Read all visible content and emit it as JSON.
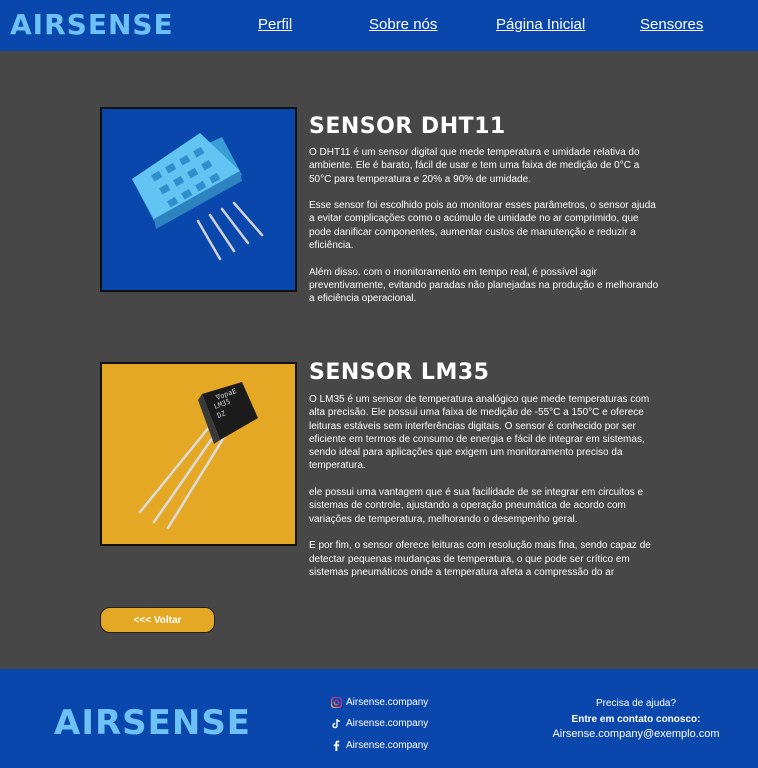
{
  "header": {
    "logo": "AIRSENSE",
    "nav": [
      "Perfil",
      "Sobre nós",
      "Página Inicial",
      "Sensores"
    ]
  },
  "sensors": [
    {
      "title": "SENSOR DHT11",
      "image_bg": "#0a47ad",
      "paragraphs": [
        "O DHT11 é um sensor digital que mede temperatura e umidade relativa do ambiente. Ele é barato, fácil de usar e tem uma faixa de medição de 0°C a 50°C para temperatura e 20% a 90% de umidade.",
        "Esse sensor foi escolhido pois ao monitorar esses parâmetros, o sensor ajuda a evitar complicações como o acúmulo de umidade no ar comprimido, que pode danificar componentes, aumentar custos de manutenção e reduzir a eficiência.",
        "Além disso. com o monitoramento em tempo real, é possível agir preventivamente, evitando paradas não planejadas na produção e melhorando a eficiência operacional."
      ]
    },
    {
      "title": "SENSOR LM35",
      "image_bg": "#e5a825",
      "chip_text": [
        "∇opaE",
        "LM35",
        "DZ"
      ],
      "paragraphs": [
        "O LM35 é um sensor de temperatura analógico que mede temperaturas com alta precisão. Ele possui uma faixa de medição de -55°C a 150°C e oferece leituras estáveis sem interferências digitais. O sensor é conhecido por ser eficiente em termos de consumo de energia e fácil de integrar em sistemas, sendo ideal para aplicações que exigem um monitoramento preciso da temperatura.",
        "ele possui uma vantagem que é sua facilidade de se integrar em circuitos e sistemas de controle, ajustando a operação pneumática de acordo com variações de temperatura, melhorando o desempenho geral.",
        "E por fim, o sensor oferece leituras com resolução mais fina, sendo capaz de detectar pequenas mudanças de temperatura, o que pode ser crítico em sistemas pneumáticos onde a temperatura afeta a compressão do ar"
      ]
    }
  ],
  "back_button": "<<< Voltar",
  "footer": {
    "logo": "AIRSENSE",
    "social": [
      {
        "icon": "instagram-icon",
        "label": "Airsense.company"
      },
      {
        "icon": "tiktok-icon",
        "label": "Airsense.company"
      },
      {
        "icon": "facebook-icon",
        "label": "Airsense.company"
      }
    ],
    "help_question": "Precisa de ajuda?",
    "help_contact": "Entre em contato conosco:",
    "help_email": "Airsense.company@exemplo.com"
  },
  "colors": {
    "header_bg": "#0a47ad",
    "page_bg": "#474747",
    "logo": "#6ec1f5",
    "button": "#e5a825"
  }
}
